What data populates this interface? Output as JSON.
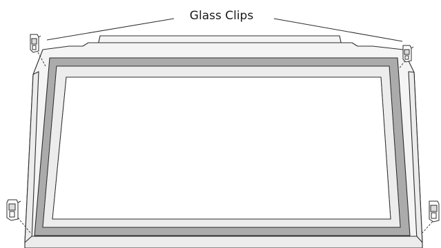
{
  "callout": {
    "label": "Glass Clips"
  },
  "colors": {
    "outline": "#2b2b2b",
    "gasket": "#ababab",
    "panel_fill": "#ffffff",
    "frame_fill": "#f4f4f4",
    "background": "#ffffff"
  },
  "parts": {
    "glass_clip_count": 4
  }
}
